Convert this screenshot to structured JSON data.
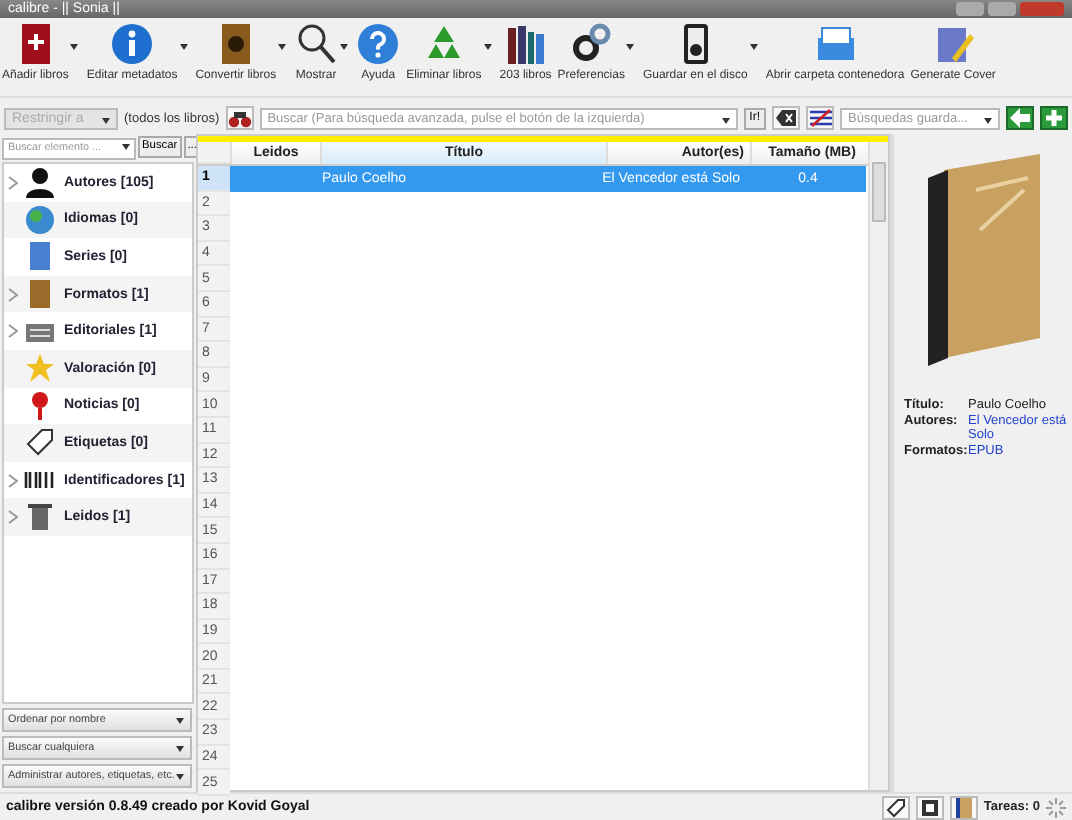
{
  "window": {
    "title": "calibre - || Sonia ||"
  },
  "toolbar": [
    {
      "label": "Añadir libros",
      "menu": true
    },
    {
      "label": "Editar metadatos",
      "menu": true
    },
    {
      "label": "Convertir libros",
      "menu": true
    },
    {
      "label": "Mostrar",
      "menu": true
    },
    {
      "label": "Ayuda",
      "menu": false
    },
    {
      "label": "Eliminar libros",
      "menu": true
    },
    {
      "label": "203 libros",
      "menu": false
    },
    {
      "label": "Preferencias",
      "menu": true
    },
    {
      "label": "Guardar en el disco",
      "menu": true
    },
    {
      "label": "Abrir carpeta contenedora",
      "menu": false
    },
    {
      "label": "Generate Cover",
      "menu": false
    }
  ],
  "search_bar": {
    "restrict": "Restringir a",
    "restrict_disabled": true,
    "scope": "(todos los libros)",
    "placeholder": "Buscar (Para búsqueda avanzada, pulse el botón de la izquierda)",
    "go": "Ir!",
    "saved_placeholder": "Búsquedas guarda..."
  },
  "tag_browser": {
    "placeholder": "Buscar elemento ...",
    "find": "Buscar",
    "more": "...",
    "items": [
      {
        "label": "Autores [105]",
        "expandable": true
      },
      {
        "label": "Idiomas [0]",
        "expandable": false
      },
      {
        "label": "Series [0]",
        "expandable": false
      },
      {
        "label": "Formatos [1]",
        "expandable": true
      },
      {
        "label": "Editoriales [1]",
        "expandable": true
      },
      {
        "label": "Valoración [0]",
        "expandable": false
      },
      {
        "label": "Noticias [0]",
        "expandable": false
      },
      {
        "label": "Etiquetas [0]",
        "expandable": false
      },
      {
        "label": "Identificadores [1]",
        "expandable": true
      },
      {
        "label": "Leidos [1]",
        "expandable": true
      }
    ],
    "dropdowns": [
      "Ordenar por nombre",
      "Buscar cualquiera",
      "Administrar autores, etiquetas, etc."
    ]
  },
  "table": {
    "columns": [
      "Leidos",
      "Título",
      "Autor(es)",
      "Tamaño (MB)"
    ],
    "rows": [
      {
        "number": "1",
        "selected": true,
        "cells": [
          "",
          "Paulo Coelho",
          "El Vencedor está Solo",
          "0.4"
        ]
      },
      {
        "number": "2",
        "selected": false,
        "cells": []
      },
      {
        "number": "3",
        "selected": false,
        "cells": []
      },
      {
        "number": "4",
        "selected": false,
        "cells": []
      },
      {
        "number": "5",
        "selected": false,
        "cells": []
      },
      {
        "number": "6",
        "selected": false,
        "cells": []
      },
      {
        "number": "7",
        "selected": false,
        "cells": []
      },
      {
        "number": "8",
        "selected": false,
        "cells": []
      },
      {
        "number": "9",
        "selected": false,
        "cells": []
      },
      {
        "number": "10",
        "selected": false,
        "cells": []
      },
      {
        "number": "11",
        "selected": false,
        "cells": []
      },
      {
        "number": "12",
        "selected": false,
        "cells": []
      },
      {
        "number": "13",
        "selected": false,
        "cells": []
      },
      {
        "number": "14",
        "selected": false,
        "cells": []
      },
      {
        "number": "15",
        "selected": false,
        "cells": []
      },
      {
        "number": "16",
        "selected": false,
        "cells": []
      },
      {
        "number": "17",
        "selected": false,
        "cells": []
      },
      {
        "number": "18",
        "selected": false,
        "cells": []
      },
      {
        "number": "19",
        "selected": false,
        "cells": []
      },
      {
        "number": "20",
        "selected": false,
        "cells": []
      },
      {
        "number": "21",
        "selected": false,
        "cells": []
      },
      {
        "number": "22",
        "selected": false,
        "cells": []
      },
      {
        "number": "23",
        "selected": false,
        "cells": []
      },
      {
        "number": "24",
        "selected": false,
        "cells": []
      },
      {
        "number": "25",
        "selected": false,
        "cells": []
      }
    ]
  },
  "details": [
    {
      "label": "Título:",
      "value": "Paulo Coelho",
      "link": false
    },
    {
      "label": "Autores:",
      "value": "El Vencedor está Solo",
      "link": true
    },
    {
      "label": "Formatos:",
      "value": "EPUB",
      "link": true
    }
  ],
  "status_bar": {
    "text": "calibre versión 0.8.49 creado por Kovid Goyal",
    "jobs": "Tareas: 0"
  }
}
